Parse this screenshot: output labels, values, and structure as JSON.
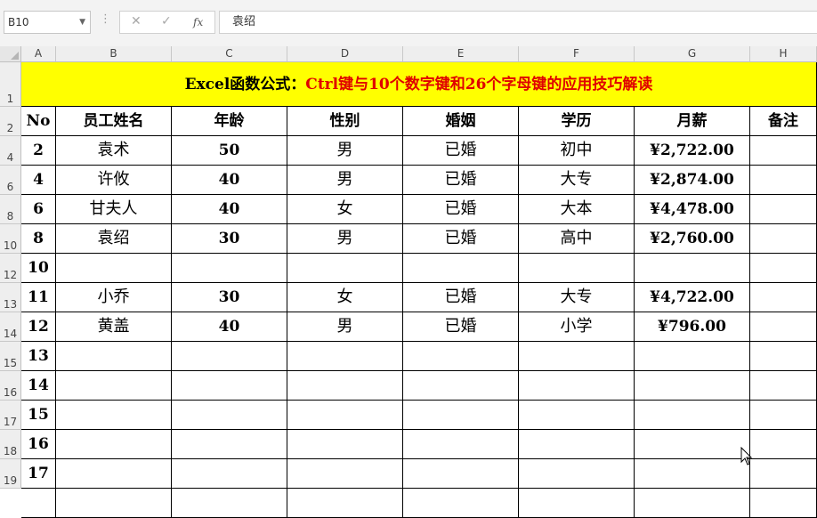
{
  "name_box": "B10",
  "formula_icons": {
    "cancel": "✕",
    "enter": "✓",
    "fx": "fx",
    "more": "⋮"
  },
  "formula_value": "袁绍",
  "columns": [
    "A",
    "B",
    "C",
    "D",
    "E",
    "F",
    "G",
    "H"
  ],
  "row_numbers": [
    "1",
    "2",
    "4",
    "6",
    "8",
    "10",
    "12",
    "13",
    "14",
    "15",
    "16",
    "17",
    "18",
    "19"
  ],
  "title_black": "Excel函数公式：",
  "title_red": "Ctrl键与10个数字键和26个字母键的应用技巧解读",
  "headers": [
    "No",
    "员工姓名",
    "年龄",
    "性别",
    "婚姻",
    "学历",
    "月薪",
    "备注"
  ],
  "rows": [
    [
      "2",
      "袁术",
      "50",
      "男",
      "已婚",
      "初中",
      "¥2,722.00",
      ""
    ],
    [
      "4",
      "许攸",
      "40",
      "男",
      "已婚",
      "大专",
      "¥2,874.00",
      ""
    ],
    [
      "6",
      "甘夫人",
      "40",
      "女",
      "已婚",
      "大本",
      "¥4,478.00",
      ""
    ],
    [
      "8",
      "袁绍",
      "30",
      "男",
      "已婚",
      "高中",
      "¥2,760.00",
      ""
    ],
    [
      "10",
      "",
      "",
      "",
      "",
      "",
      "",
      ""
    ],
    [
      "11",
      "小乔",
      "30",
      "女",
      "已婚",
      "大专",
      "¥4,722.00",
      ""
    ],
    [
      "12",
      "黄盖",
      "40",
      "男",
      "已婚",
      "小学",
      "¥796.00",
      ""
    ],
    [
      "13",
      "",
      "",
      "",
      "",
      "",
      "",
      ""
    ],
    [
      "14",
      "",
      "",
      "",
      "",
      "",
      "",
      ""
    ],
    [
      "15",
      "",
      "",
      "",
      "",
      "",
      "",
      ""
    ],
    [
      "16",
      "",
      "",
      "",
      "",
      "",
      "",
      ""
    ],
    [
      "17",
      "",
      "",
      "",
      "",
      "",
      "",
      ""
    ],
    [
      "",
      "",
      "",
      "",
      "",
      "",
      "",
      ""
    ]
  ],
  "colors": {
    "title_bg": "#ffff00",
    "title_red": "#e00000",
    "grid": "#000000"
  }
}
